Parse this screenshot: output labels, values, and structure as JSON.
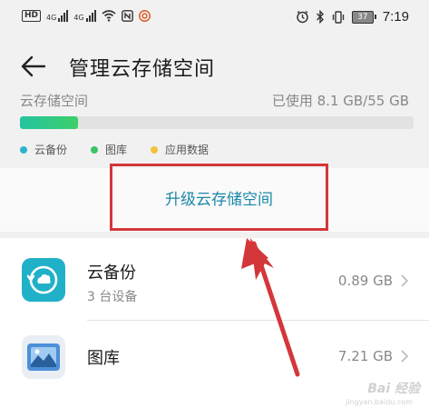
{
  "status_bar": {
    "hd": "HD",
    "net1": "4G",
    "net2": "4G",
    "battery": "37",
    "time": "7:19"
  },
  "header": {
    "title": "管理云存储空间"
  },
  "storage": {
    "label": "云存储空间",
    "used_text": "已使用 8.1 GB/55 GB",
    "used_fraction": 0.147
  },
  "legend": [
    {
      "label": "云备份",
      "color": "#2bb5cc"
    },
    {
      "label": "图库",
      "color": "#3bc36a"
    },
    {
      "label": "应用数据",
      "color": "#f2c33a"
    }
  ],
  "upgrade": {
    "label": "升级云存储空间"
  },
  "list": [
    {
      "title": "云备份",
      "subtitle": "3 台设备",
      "size": "0.89 GB",
      "icon": "cloud-backup-icon"
    },
    {
      "title": "图库",
      "subtitle": "",
      "size": "7.21 GB",
      "icon": "gallery-icon"
    }
  ],
  "annotation": {
    "color": "#d4373a"
  },
  "watermark": {
    "brand": "Bai 经验",
    "url": "jingyan.baidu.com"
  }
}
